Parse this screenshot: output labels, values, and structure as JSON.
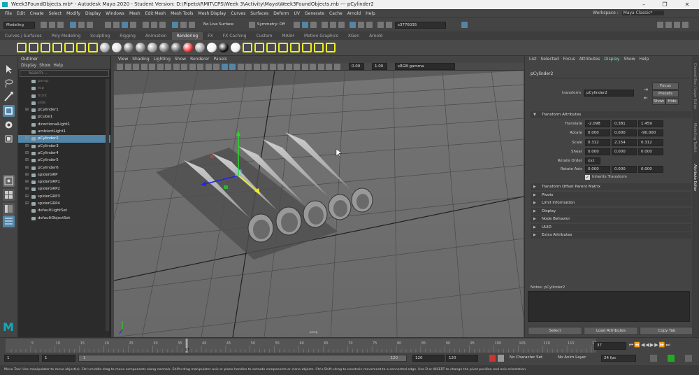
{
  "window": {
    "title": "Week3FoundObjects.mb* - Autodesk Maya 2020 - Student Version: D:\\Pipeto\\RMIT\\CPS\\Week 3\\Activity\\Maya\\Week3FoundObjects.mb  ---  pCylinder2",
    "minimize": "–",
    "maximize": "❐",
    "close": "✕"
  },
  "menubar": [
    "File",
    "Edit",
    "Create",
    "Select",
    "Modify",
    "Display",
    "Windows",
    "Mesh",
    "Edit Mesh",
    "Mesh Tools",
    "Mesh Display",
    "Curves",
    "Surfaces",
    "Deform",
    "UV",
    "Generate",
    "Cache",
    "Arnold",
    "Help"
  ],
  "workspace": {
    "label": "Workspace :",
    "value": "Maya Classic*"
  },
  "statusline": {
    "mode": "Modeling",
    "live": "No Live Surface",
    "symmetry": "Symmetry: Off",
    "user": "s3776035"
  },
  "shelf_tabs": [
    "Curves / Surfaces",
    "Poly Modeling",
    "Sculpting",
    "Rigging",
    "Animation",
    "Rendering",
    "FX",
    "FX Caching",
    "Custom",
    "MASH",
    "Motion Graphics",
    "XGen",
    "Arnold"
  ],
  "shelf_active": "Rendering",
  "outliner": {
    "title": "Outliner",
    "menu": [
      "Display",
      "Show",
      "Help"
    ],
    "search_placeholder": "Search...",
    "items": [
      {
        "label": "persp",
        "state": "dim",
        "exp": ""
      },
      {
        "label": "top",
        "state": "dim",
        "exp": ""
      },
      {
        "label": "front",
        "state": "dim",
        "exp": ""
      },
      {
        "label": "side",
        "state": "dim",
        "exp": ""
      },
      {
        "label": "pCylinder1",
        "state": "",
        "exp": "⊞"
      },
      {
        "label": "pCube1",
        "state": "",
        "exp": ""
      },
      {
        "label": "directionalLight1",
        "state": "",
        "exp": ""
      },
      {
        "label": "ambientLight1",
        "state": "",
        "exp": ""
      },
      {
        "label": "pCylinder2",
        "state": "sel",
        "exp": "⊞"
      },
      {
        "label": "pCylinder3",
        "state": "",
        "exp": "⊞"
      },
      {
        "label": "pCylinder4",
        "state": "",
        "exp": "⊞"
      },
      {
        "label": "pCylinder5",
        "state": "",
        "exp": "⊞"
      },
      {
        "label": "pCylinder6",
        "state": "",
        "exp": "⊞"
      },
      {
        "label": "spiderGRP",
        "state": "",
        "exp": "⊞"
      },
      {
        "label": "spiderGRP1",
        "state": "",
        "exp": "⊞"
      },
      {
        "label": "spiderGRP2",
        "state": "",
        "exp": "⊞"
      },
      {
        "label": "spiderGRP3",
        "state": "",
        "exp": "⊞"
      },
      {
        "label": "spiderGRP4",
        "state": "",
        "exp": "⊞"
      },
      {
        "label": "defaultLightSet",
        "state": "",
        "exp": ""
      },
      {
        "label": "defaultObjectSet",
        "state": "",
        "exp": ""
      }
    ]
  },
  "viewport": {
    "menu": [
      "View",
      "Shading",
      "Lighting",
      "Show",
      "Renderer",
      "Panels"
    ],
    "exposure": "0.00",
    "gamma": "1.00",
    "colorspace": "sRGB gamma",
    "camera_label": "persp"
  },
  "attr": {
    "tabs": [
      "List",
      "Selected",
      "Focus",
      "Attributes",
      "Display",
      "Show",
      "Help"
    ],
    "active_tab": "Display",
    "node_tab": "pCylinder2",
    "transform_label": "transform",
    "transform_value": "pCylinder2",
    "focus": "Focus",
    "presets": "Presets",
    "show": "Show",
    "hide": "Hide",
    "section_transform": "Transform Attributes",
    "translate": {
      "label": "Translate",
      "x": "-2.098",
      "y": "0.381",
      "z": "1.459"
    },
    "rotate": {
      "label": "Rotate",
      "x": "0.000",
      "y": "0.000",
      "z": "-90.000"
    },
    "scale": {
      "label": "Scale",
      "x": "0.312",
      "y": "2.154",
      "z": "0.312"
    },
    "shear": {
      "label": "Shear",
      "x": "0.000",
      "y": "0.000",
      "z": "0.000"
    },
    "rotate_order": {
      "label": "Rotate Order",
      "value": "xyz"
    },
    "rotate_axis": {
      "label": "Rotate Axis",
      "x": "0.000",
      "y": "0.000",
      "z": "0.000"
    },
    "inherits": "Inherits Transform",
    "sections": [
      "Transform Offset Parent Matrix",
      "Pivots",
      "Limit Information",
      "Display",
      "Node Behavior",
      "UUID",
      "Extra Attributes"
    ],
    "notes": "Notes: pCylinder2",
    "bottom_buttons": [
      "Select",
      "Load Attributes",
      "Copy Tab"
    ]
  },
  "side_tabs": [
    "Channel Box / Layer Editor",
    "Modelling Toolkit",
    "Attribute Editor"
  ],
  "timeline": {
    "ticks": [
      "5",
      "10",
      "15",
      "20",
      "25",
      "30",
      "35",
      "40",
      "45",
      "50",
      "55",
      "60",
      "65",
      "70",
      "75",
      "80",
      "85",
      "90",
      "95",
      "100",
      "105",
      "110",
      "115",
      "120"
    ],
    "current_frame": "37",
    "current_field": "37"
  },
  "range": {
    "start": "1",
    "start2": "1",
    "slider_start": "1",
    "slider_end": "120",
    "end": "120",
    "end2": "120",
    "end3": "200",
    "character_set": "No Character Set",
    "anim_layer": "No Anim Layer",
    "fps": "24 fps"
  },
  "helpline": "Move Tool: Use manipulator to move object(s). Ctrl+middle-drag to move components along normals. Shift+drag manipulator axis or plane handles to extrude components or clone objects. Ctrl+Shift+drag to constrain movement to a connected edge. Use D or INSERT to change the pivot position and axis orientation."
}
